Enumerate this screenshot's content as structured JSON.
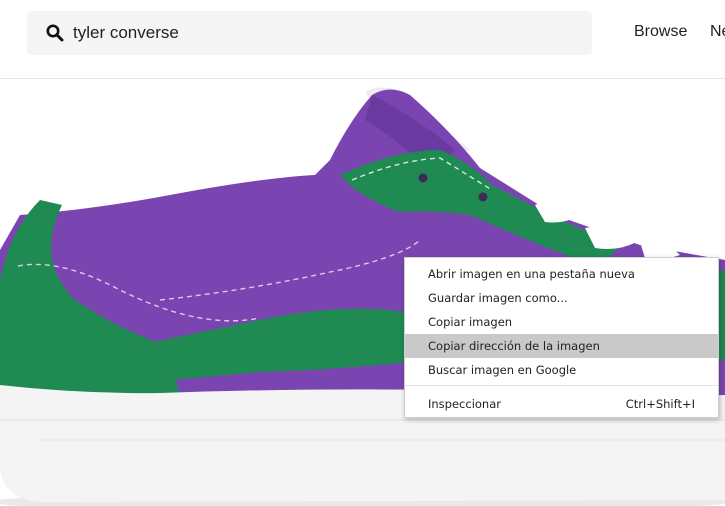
{
  "search": {
    "value": "tyler converse",
    "icon": "search-icon"
  },
  "nav": {
    "browse": "Browse",
    "next_partial": "Ne"
  },
  "product_image": {
    "alt": "tyler converse",
    "colors": {
      "upper": "#7a45b0",
      "overlay": "#1f8a52",
      "sole": "#f4f4f4",
      "laces": "#ffffff"
    }
  },
  "context_menu": {
    "items": [
      {
        "label": "Abrir imagen en una pestaña nueva"
      },
      {
        "label": "Guardar imagen como..."
      },
      {
        "label": "Copiar imagen"
      },
      {
        "label": "Copiar dirección de la imagen",
        "highlighted": true
      },
      {
        "label": "Buscar imagen en Google"
      }
    ],
    "inspect": {
      "label": "Inspeccionar",
      "shortcut": "Ctrl+Shift+I"
    }
  }
}
